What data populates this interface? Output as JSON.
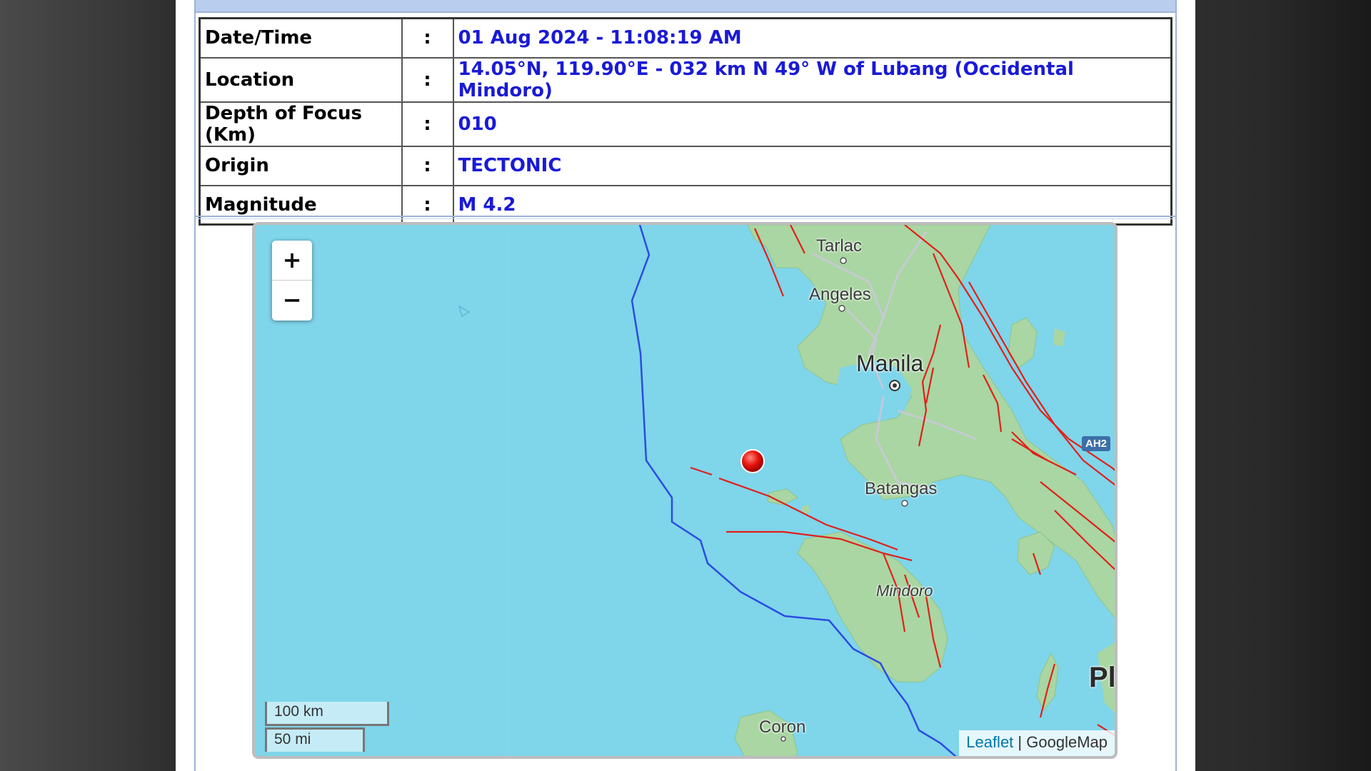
{
  "bulletin": {
    "rows": [
      {
        "label": "Date/Time",
        "colon": ":",
        "value": "01 Aug 2024 - 11:08:19 AM"
      },
      {
        "label": "Location",
        "colon": ":",
        "value": "14.05°N, 119.90°E - 032 km N 49° W of Lubang (Occidental Mindoro)"
      },
      {
        "label": "Depth of Focus (Km)",
        "colon": ":",
        "value": "010"
      },
      {
        "label": "Origin",
        "colon": ":",
        "value": "TECTONIC"
      },
      {
        "label": "Magnitude",
        "colon": ":",
        "value": "M 4.2"
      }
    ]
  },
  "map": {
    "zoom_in": "+",
    "zoom_out": "−",
    "scale_km": "100 km",
    "scale_mi": "50 mi",
    "attribution_link": "Leaflet",
    "attribution_sep": " | ",
    "attribution_source": "GoogleMap",
    "places": {
      "tarlac": "Tarlac",
      "angeles": "Angeles",
      "manila": "Manila",
      "batangas": "Batangas",
      "mindoro": "Mindoro",
      "coron": "Coron",
      "pl": "Pl",
      "route_tag": "AH2"
    },
    "epicenter_icon": "red-circle-marker",
    "colors": {
      "sea": "#7fd5ea",
      "land": "#a8d8a8",
      "fault": "#e0201a",
      "boundary": "#2b4ce0",
      "epicenter": "#e8160f",
      "value_text": "#1a1ad6"
    }
  }
}
